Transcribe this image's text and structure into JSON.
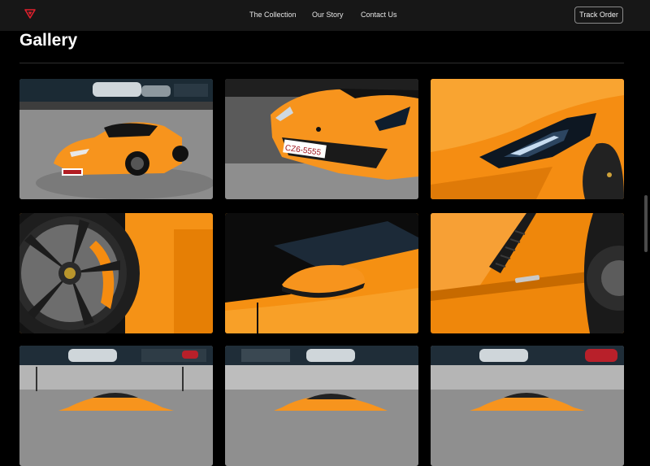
{
  "nav": {
    "logo_icon": "chevron-logo-icon",
    "accent_color": "#e0202d",
    "links": [
      "The Collection",
      "Our Story",
      "Contact Us"
    ],
    "track_order_label": "Track Order"
  },
  "gallery": {
    "title": "Gallery",
    "plate_text": "CZ6-5555",
    "images": [
      {
        "subject": "orange-lamborghini-front-quarter"
      },
      {
        "subject": "orange-lamborghini-front-bumper"
      },
      {
        "subject": "orange-lamborghini-headlight"
      },
      {
        "subject": "black-alloy-wheel-orange-caliper"
      },
      {
        "subject": "orange-lamborghini-side-mirror"
      },
      {
        "subject": "orange-lamborghini-side-vent"
      },
      {
        "subject": "orange-lamborghini-rear-view"
      },
      {
        "subject": "orange-lamborghini-front-view"
      },
      {
        "subject": "orange-lamborghini-rear-view-2"
      }
    ]
  },
  "colors": {
    "background": "#000000",
    "navbar": "#171717",
    "car_orange": "#f7941d"
  }
}
